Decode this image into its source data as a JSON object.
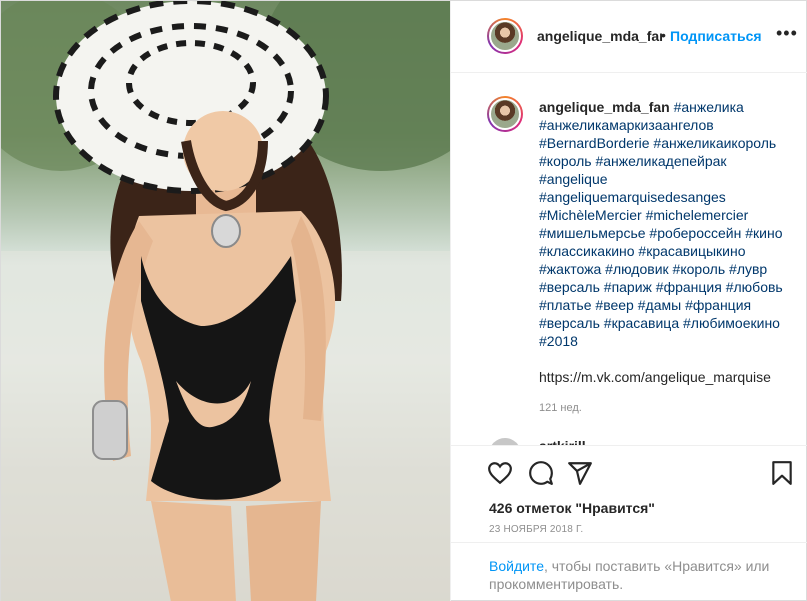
{
  "header": {
    "username": "angelique_mda_fan",
    "separator": "•",
    "follow_label": "Подписаться",
    "more_label": "•••"
  },
  "caption": {
    "username": "angelique_mda_fan",
    "hashtags": [
      "#анжелика",
      "#анжеликамаркизаангелов",
      "#BernardBorderie",
      "#анжеликаикороль",
      "#король",
      "#анжеликадепейрак",
      "#angelique",
      "#angeliquemarquisedesanges",
      "#MichèleMercier",
      "#michelemercier",
      "#мишельмерсье",
      "#робероссейн",
      "#кино",
      "#классикакино",
      "#красавицыкино",
      "#жактожа",
      "#людовик",
      "#король",
      "#лувр",
      "#версаль",
      "#париж",
      "#франция",
      "#любовь",
      "#платье",
      "#веер",
      "#дамы",
      "#франция",
      "#версаль",
      "#красавица",
      "#любимоекино",
      "#2018"
    ],
    "link": "https://m.vk.com/angelique_marquise",
    "time": "121 нед."
  },
  "next_comment": {
    "username": "artkirill"
  },
  "actions": {
    "like_icon": "heart-icon",
    "comment_icon": "comment-icon",
    "share_icon": "paper-plane-icon",
    "save_icon": "bookmark-icon",
    "likes_text": "426 отметок \"Нравится\"",
    "date": "23 НОЯБРЯ 2018 Г."
  },
  "login_prompt": {
    "link_label": "Войдите",
    "text": ", чтобы поставить «Нравится» или прокомментировать."
  },
  "colors": {
    "accent": "#0095f6",
    "hashtag": "#00376b",
    "muted": "#8e8e8e",
    "text": "#262626"
  }
}
